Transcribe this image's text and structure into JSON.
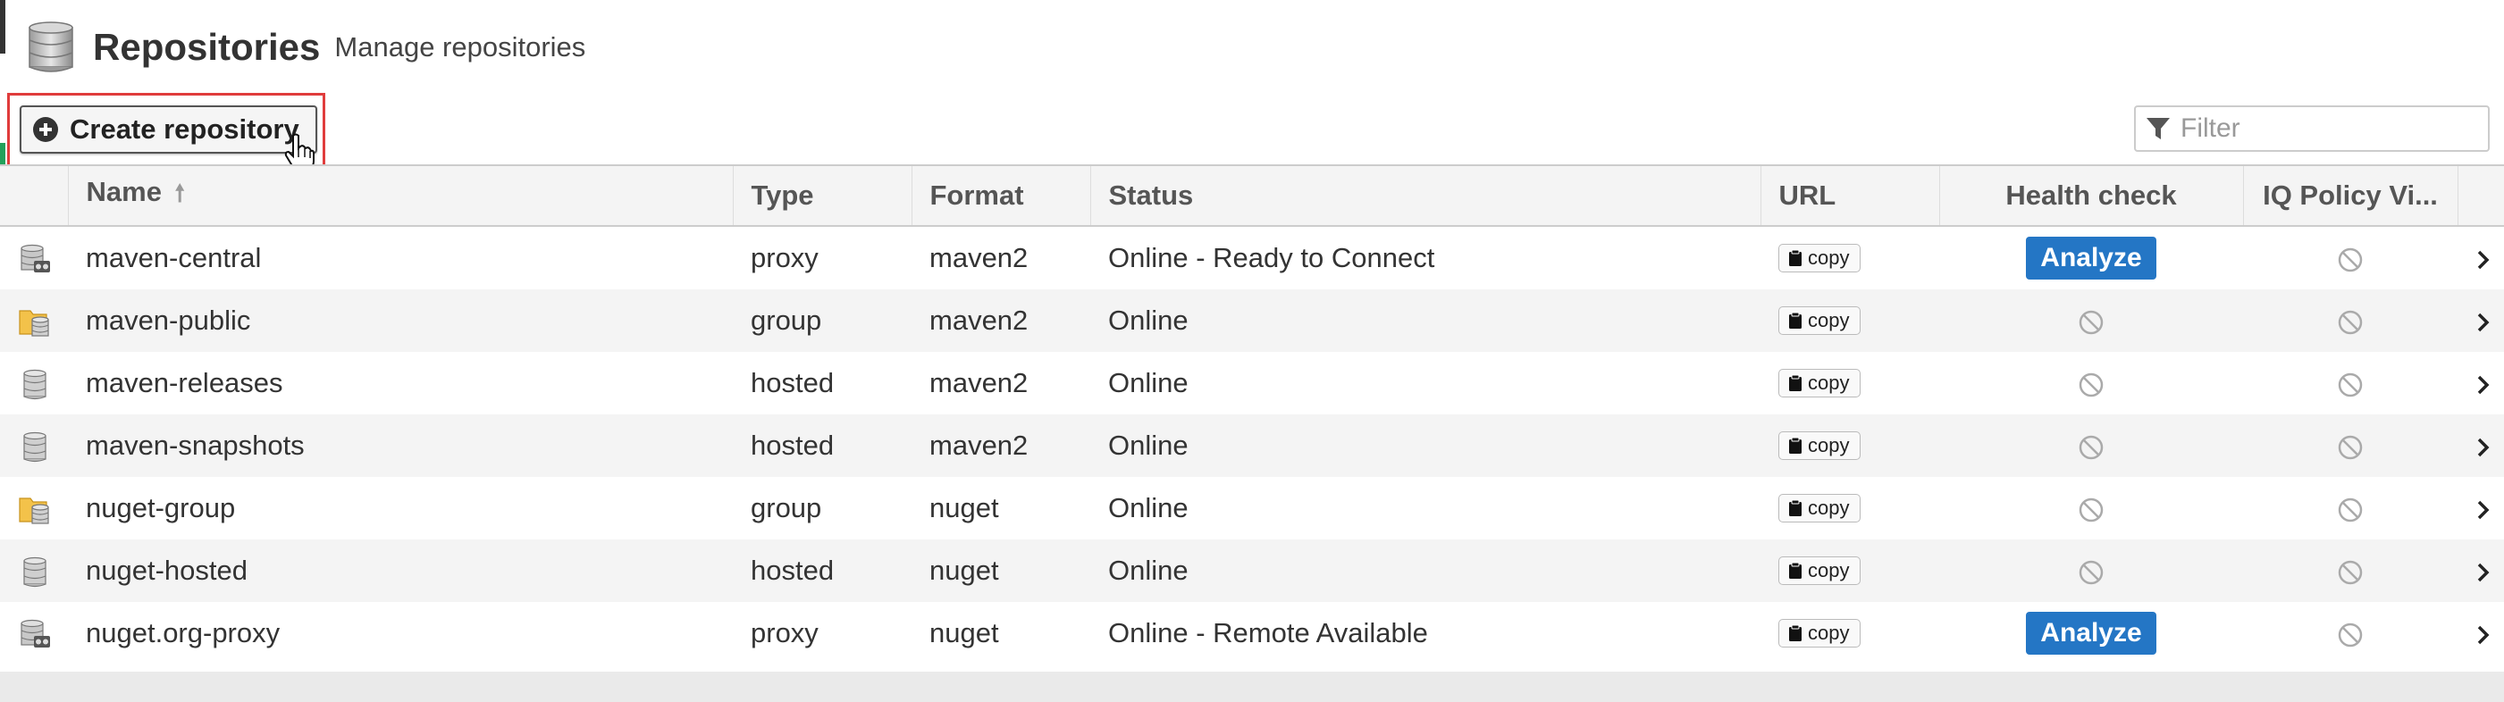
{
  "header": {
    "title": "Repositories",
    "subtitle": "Manage repositories",
    "icon": "database-icon"
  },
  "toolbar": {
    "create_label": "Create repository",
    "filter_placeholder": "Filter",
    "filter_value": ""
  },
  "table": {
    "columns": {
      "name": "Name",
      "type": "Type",
      "format": "Format",
      "status": "Status",
      "url": "URL",
      "health": "Health check",
      "iq": "IQ Policy Vi..."
    },
    "sort": {
      "column": "name",
      "direction": "ascending"
    },
    "copy_label": "copy",
    "analyze_label": "Analyze",
    "rows": [
      {
        "icon": "proxy-repo-icon",
        "name": "maven-central",
        "type": "proxy",
        "format": "maven2",
        "status": "Online - Ready to Connect",
        "health": "analyze"
      },
      {
        "icon": "group-repo-icon",
        "name": "maven-public",
        "type": "group",
        "format": "maven2",
        "status": "Online",
        "health": "na"
      },
      {
        "icon": "hosted-repo-icon",
        "name": "maven-releases",
        "type": "hosted",
        "format": "maven2",
        "status": "Online",
        "health": "na"
      },
      {
        "icon": "hosted-repo-icon",
        "name": "maven-snapshots",
        "type": "hosted",
        "format": "maven2",
        "status": "Online",
        "health": "na"
      },
      {
        "icon": "group-repo-icon",
        "name": "nuget-group",
        "type": "group",
        "format": "nuget",
        "status": "Online",
        "health": "na"
      },
      {
        "icon": "hosted-repo-icon",
        "name": "nuget-hosted",
        "type": "hosted",
        "format": "nuget",
        "status": "Online",
        "health": "na"
      },
      {
        "icon": "proxy-repo-icon",
        "name": "nuget.org-proxy",
        "type": "proxy",
        "format": "nuget",
        "status": "Online - Remote Available",
        "health": "analyze"
      }
    ]
  },
  "colors": {
    "analyze_button": "#2476c5",
    "highlight_border": "#e03c3c",
    "row_stripe": "#f4f4f4"
  }
}
